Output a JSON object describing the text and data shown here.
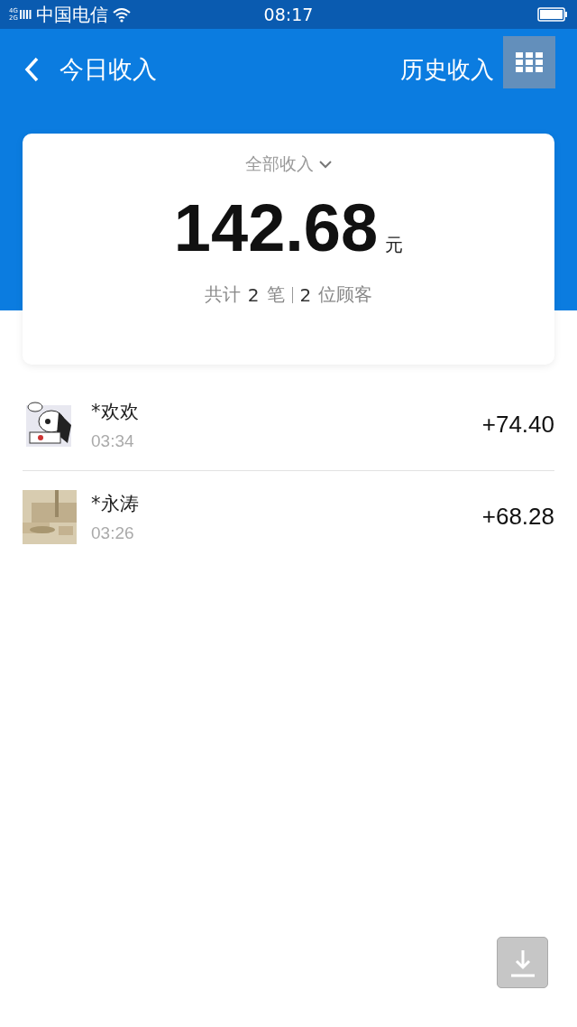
{
  "status_bar": {
    "network_top": "4G",
    "network_bottom": "2G",
    "carrier": "中国电信",
    "time": "08:17"
  },
  "header": {
    "title": "今日收入",
    "action": "历史收入"
  },
  "summary": {
    "filter": "全部收入",
    "amount": "142.68",
    "unit": "元",
    "count_prefix": "共计",
    "count": "2",
    "count_unit": "笔",
    "customers": "2",
    "customers_unit": "位顾客"
  },
  "transactions": [
    {
      "name": "*欢欢",
      "time": "03:34",
      "amount": "+74.40"
    },
    {
      "name": "*永涛",
      "time": "03:26",
      "amount": "+68.28"
    }
  ]
}
